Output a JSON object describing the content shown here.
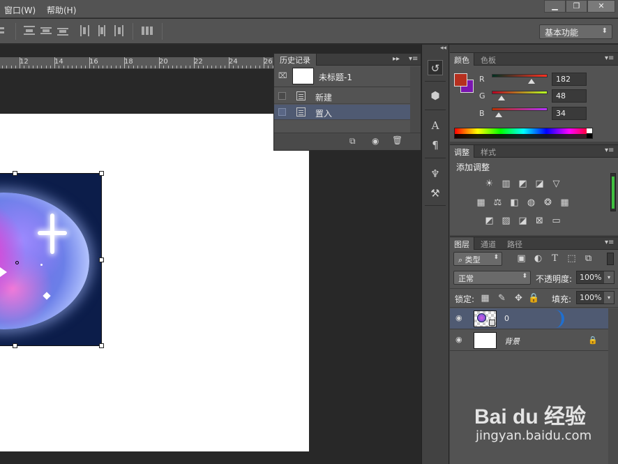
{
  "menu": {
    "window": "窗口(W)",
    "help": "帮助(H)"
  },
  "window_controls": {
    "minimize": "▁",
    "restore": "❐",
    "close": "✕"
  },
  "options_bar": {
    "workspace": "基本功能"
  },
  "ruler": {
    "labels": [
      "12",
      "14",
      "16",
      "18",
      "20",
      "22",
      "24",
      "26"
    ]
  },
  "history": {
    "tab": "历史记录",
    "snapshot": "未标题-1",
    "items": [
      {
        "label": "新建",
        "selected": false
      },
      {
        "label": "置入",
        "selected": true
      }
    ]
  },
  "color_panel": {
    "tabs": [
      "颜色",
      "色板"
    ],
    "foreground": "#b6301f",
    "background": "#7a16b0",
    "channels": [
      {
        "label": "R",
        "value": "182"
      },
      {
        "label": "G",
        "value": "48"
      },
      {
        "label": "B",
        "value": "34"
      }
    ]
  },
  "adjust_panel": {
    "tabs": [
      "调整",
      "样式"
    ],
    "title": "添加调整"
  },
  "layers_panel": {
    "tabs": [
      "图层",
      "通道",
      "路径"
    ],
    "filter_kind": "类型",
    "blend_mode": "正常",
    "opacity_label": "不透明度:",
    "opacity": "100%",
    "lock_label": "锁定:",
    "fill_label": "填充:",
    "fill": "100%",
    "layers": [
      {
        "name": "0",
        "selected": true
      },
      {
        "name": "背景",
        "selected": false
      }
    ]
  },
  "watermark": {
    "brand": "Bai du 经验",
    "url": "jingyan.baidu.com"
  }
}
